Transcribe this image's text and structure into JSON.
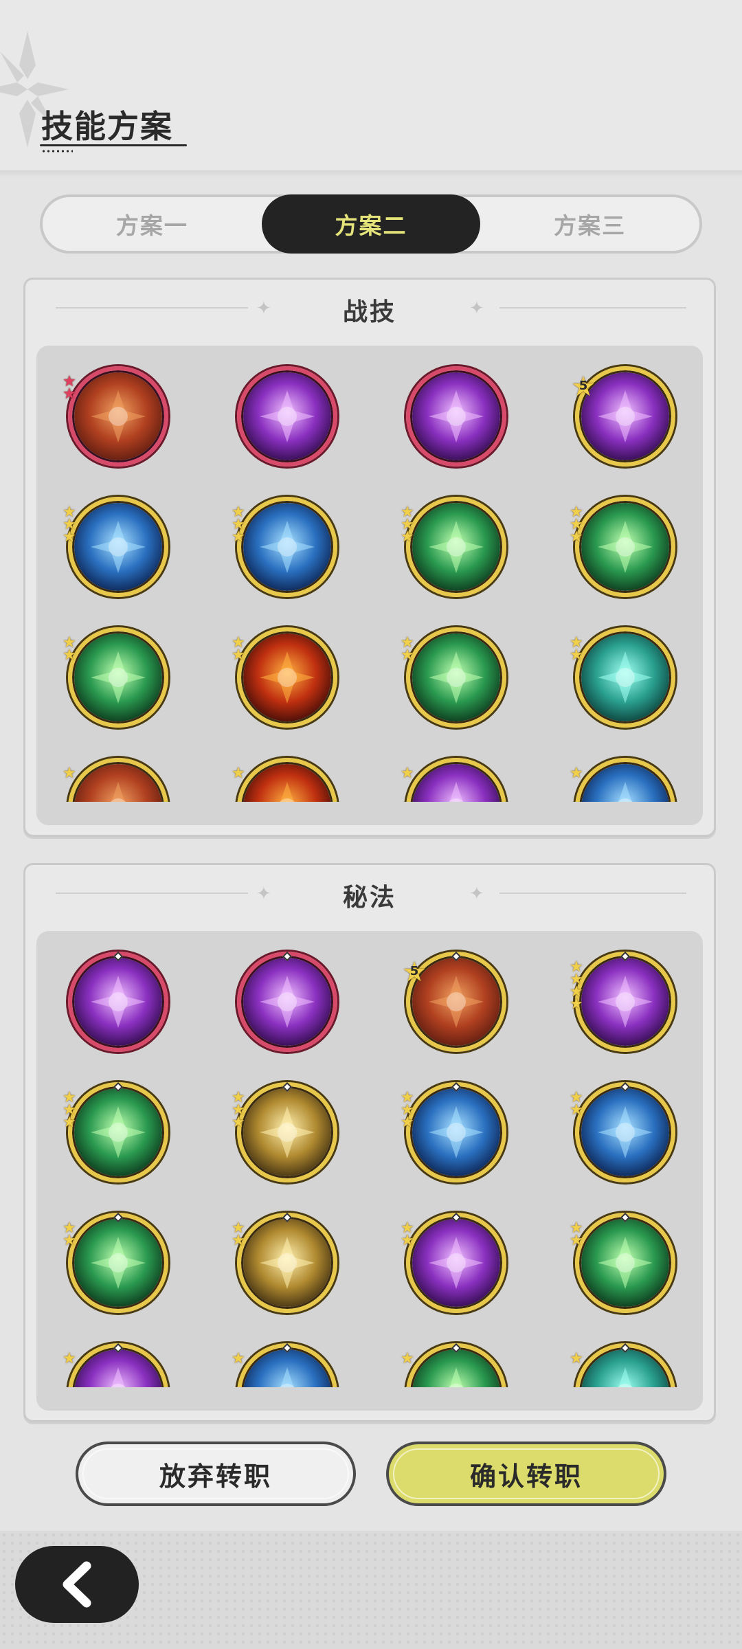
{
  "header": {
    "title": "技能方案"
  },
  "tabs": [
    {
      "label": "方案一",
      "active": false
    },
    {
      "label": "方案二",
      "active": true
    },
    {
      "label": "方案三",
      "active": false
    }
  ],
  "battle_skills": {
    "title": "战技",
    "items": [
      {
        "icon": "orange-totem-skill-icon",
        "frame": "red",
        "stars": 2
      },
      {
        "icon": "purple-star-burst-skill-icon",
        "frame": "red",
        "stars": 0
      },
      {
        "icon": "violet-shatter-skill-icon",
        "frame": "red",
        "stars": 0
      },
      {
        "icon": "purple-hand-skill-icon",
        "frame": "gold",
        "star_number": "5"
      },
      {
        "icon": "ice-crystal-skill-icon",
        "frame": "gold",
        "stars": 3
      },
      {
        "icon": "water-slime-skill-icon",
        "frame": "gold",
        "stars": 3
      },
      {
        "icon": "green-wind-slash-skill-icon",
        "frame": "gold",
        "stars": 3
      },
      {
        "icon": "green-heal-plus-skill-icon",
        "frame": "gold",
        "stars": 3
      },
      {
        "icon": "tree-stump-skill-icon",
        "frame": "gold",
        "stars": 2
      },
      {
        "icon": "fire-swirl-skill-icon",
        "frame": "gold",
        "stars": 2
      },
      {
        "icon": "green-flame-skill-icon",
        "frame": "gold",
        "stars": 2
      },
      {
        "icon": "teal-vortex-skill-icon",
        "frame": "gold",
        "stars": 2
      },
      {
        "icon": "rock-skill-icon",
        "frame": "gold",
        "stars": 1
      },
      {
        "icon": "red-fire-skill-icon",
        "frame": "gold",
        "stars": 1
      },
      {
        "icon": "purple-constellation-skill-icon",
        "frame": "gold",
        "stars": 1
      },
      {
        "icon": "blue-water-skill-icon",
        "frame": "gold",
        "stars": 1
      }
    ]
  },
  "secret_arts": {
    "title": "秘法",
    "items": [
      {
        "icon": "purple-heart-figure-skill-icon",
        "frame": "red",
        "stars": 0
      },
      {
        "icon": "purple-rising-figure-skill-icon",
        "frame": "red",
        "stars": 0
      },
      {
        "icon": "red-fist-skill-icon",
        "frame": "gold",
        "star_number": "5"
      },
      {
        "icon": "purple-eye-hand-skill-icon",
        "frame": "gold",
        "stars": 4
      },
      {
        "icon": "green-star-shield-skill-icon",
        "frame": "gold",
        "stars": 3
      },
      {
        "icon": "golden-arrow-skill-icon",
        "frame": "gold",
        "stars": 3
      },
      {
        "icon": "blue-diamond-skill-icon",
        "frame": "gold",
        "stars": 3
      },
      {
        "icon": "ice-shard-skill-icon",
        "frame": "gold",
        "stars": 2
      },
      {
        "icon": "green-heart-skill-icon",
        "frame": "gold",
        "stars": 2
      },
      {
        "icon": "golden-wing-skill-icon",
        "frame": "gold",
        "stars": 2
      },
      {
        "icon": "purple-eye-skill-icon",
        "frame": "gold",
        "stars": 2
      },
      {
        "icon": "green-sparkle-skill-icon",
        "frame": "gold",
        "stars": 2
      },
      {
        "icon": "purple-orb-skill-icon",
        "frame": "gold",
        "stars": 1
      },
      {
        "icon": "blue-armor-skill-icon",
        "frame": "gold",
        "stars": 1
      },
      {
        "icon": "green-burst-skill-icon",
        "frame": "gold",
        "stars": 1
      },
      {
        "icon": "teal-swirl-skill-icon",
        "frame": "gold",
        "stars": 1
      }
    ]
  },
  "buttons": {
    "abandon": "放弃转职",
    "confirm": "确认转职"
  },
  "colors": {
    "tab_active_bg": "#232323",
    "tab_active_text": "#e5e47a",
    "confirm_bg": "#dcdc6c",
    "frame_gold": "#e7c84a",
    "frame_red": "#d84a6a"
  }
}
